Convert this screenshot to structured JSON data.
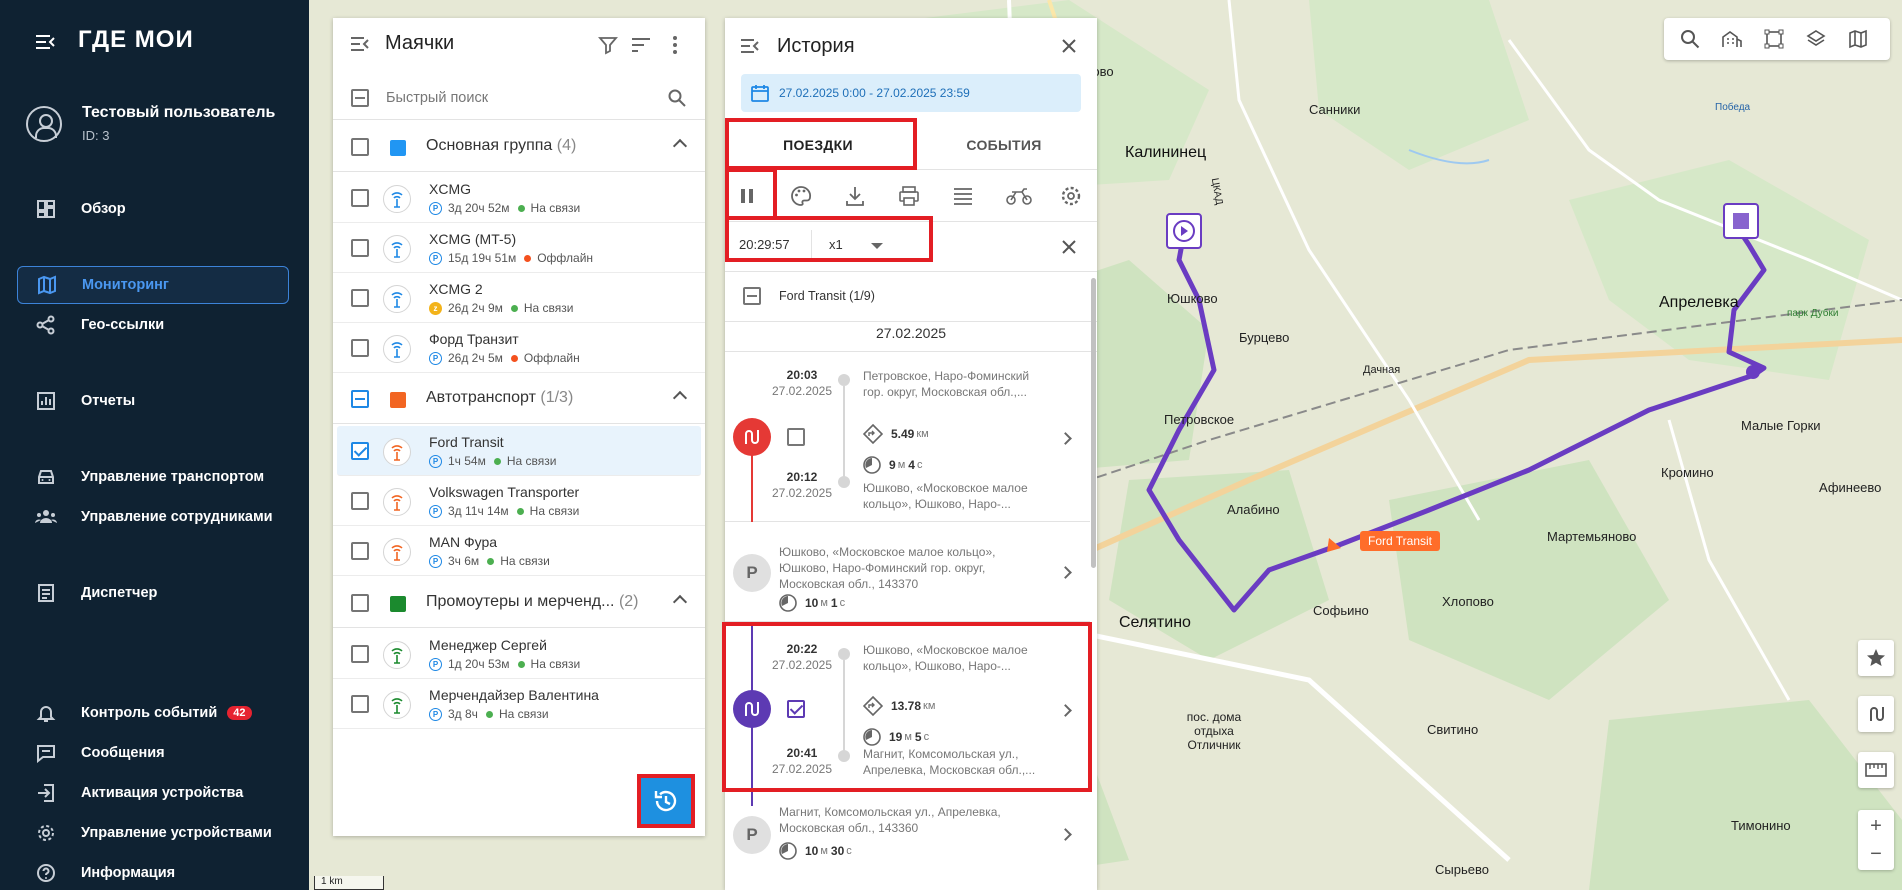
{
  "sidebar": {
    "logo": "ГДЕ МОИ",
    "user": {
      "name": "Тестовый пользователь",
      "id": "ID: 3"
    },
    "nav": [
      {
        "label": "Обзор",
        "icon": "dashboard-icon"
      },
      {
        "label": "Мониторинг",
        "icon": "map-icon",
        "active": true
      },
      {
        "label": "Гео-ссылки",
        "icon": "share-icon"
      },
      {
        "label": "Отчеты",
        "icon": "chart-icon"
      },
      {
        "label": "Управление транспортом",
        "icon": "car-icon"
      },
      {
        "label": "Управление сотрудниками",
        "icon": "people-icon"
      },
      {
        "label": "Диспетчер",
        "icon": "document-icon"
      },
      {
        "label": "Контроль событий",
        "icon": "bell-icon",
        "badge": "42"
      },
      {
        "label": "Сообщения",
        "icon": "message-icon"
      },
      {
        "label": "Активация устройства",
        "icon": "login-icon"
      },
      {
        "label": "Управление устройствами",
        "icon": "gear-icon"
      },
      {
        "label": "Информация",
        "icon": "help-icon"
      }
    ]
  },
  "beacons": {
    "title": "Маячки",
    "search_placeholder": "Быстрый поиск",
    "groups": [
      {
        "name": "Основная группа",
        "count": "(4)",
        "color": "#2196f3",
        "devices": [
          {
            "name": "XCMG",
            "duration": "3д 20ч 52м",
            "status": "На связи",
            "status_color": "#4caf50"
          },
          {
            "name": "XCMG (MT-5)",
            "duration": "15д 19ч 51м",
            "status": "Оффлайн",
            "status_color": "#f4511e"
          },
          {
            "name": "XCMG 2",
            "duration": "26д 2ч 9м",
            "status": "На связи",
            "status_color": "#4caf50"
          },
          {
            "name": "Форд Транзит",
            "duration": "26д 2ч 5м",
            "status": "Оффлайн",
            "status_color": "#f4511e"
          }
        ]
      },
      {
        "name": "Автотранспорт",
        "count": "(1/3)",
        "color": "#f26522",
        "devices": [
          {
            "name": "Ford Transit",
            "duration": "1ч 54м",
            "status": "На связи",
            "status_color": "#4caf50"
          },
          {
            "name": "Volkswagen Transporter",
            "duration": "3д 11ч 14м",
            "status": "На связи",
            "status_color": "#4caf50"
          },
          {
            "name": "MAN Фура",
            "duration": "3ч 6м",
            "status": "На связи",
            "status_color": "#4caf50"
          }
        ]
      },
      {
        "name": "Промоутеры и мерченд...",
        "count": "(2)",
        "color": "#1b8a2e",
        "devices": [
          {
            "name": "Менеджер Сергей",
            "duration": "1д 20ч 53м",
            "status": "На связи",
            "status_color": "#4caf50"
          },
          {
            "name": "Мерчендайзер Валентина",
            "duration": "3д 8ч",
            "status": "На связи",
            "status_color": "#4caf50"
          }
        ]
      }
    ]
  },
  "history": {
    "title": "История",
    "date_range": "27.02.2025 0:00 - 27.02.2025 23:59",
    "tabs": [
      "ПОЕЗДКИ",
      "СОБЫТИЯ"
    ],
    "player_time": "20:29:57",
    "speed": "x1",
    "trip_header": "Ford Transit",
    "trip_count": "(1/9)",
    "date": "27.02.2025",
    "entries": [
      {
        "type": "trip",
        "start_time": "20:03",
        "start_date": "27.02.2025",
        "start_addr": "Петровское, Наро-Фоминский гор. округ, Московская обл.,...",
        "end_time": "20:12",
        "end_date": "27.02.2025",
        "end_addr": "Юшково, «Московское малое кольцо», Юшково, Наро-...",
        "distance": "5.49",
        "distance_unit": "км",
        "min": "9",
        "sec": "4"
      },
      {
        "type": "parking",
        "addr": "Юшково, «Московское малое кольцо», Юшково, Наро-Фоминский гор. округ, Московская обл., 143370",
        "min": "10",
        "sec": "1"
      },
      {
        "type": "trip",
        "start_time": "20:22",
        "start_date": "27.02.2025",
        "start_addr": "Юшково, «Московское малое кольцо», Юшково, Наро-...",
        "end_time": "20:41",
        "end_date": "27.02.2025",
        "end_addr": "Магнит, Комсомольская ул., Апрелевка, Московская обл.,...",
        "distance": "13.78",
        "distance_unit": "км",
        "min": "19",
        "sec": "5"
      },
      {
        "type": "parking",
        "addr": "Магнит, Комсомольская ул., Апрелевка, Московская обл., 143360",
        "min": "10",
        "sec": "30"
      }
    ],
    "units": {
      "min": "м",
      "sec": "с"
    }
  },
  "map": {
    "labels": [
      "Тарасково",
      "Санники",
      "Калининец",
      "Победа",
      "Апрелевка",
      "парк Дубки",
      "Юшково",
      "Бурцево",
      "Дачная",
      "Петровское",
      "Малые Горки",
      "Алабино",
      "Кромино",
      "Афинеево",
      "Мартемьяново",
      "Селятино",
      "Софьино",
      "Хлопово",
      "пос. дома отдыха Отличник",
      "Свитино",
      "Тимонино",
      "Сырьево",
      "ЦКАД",
      "Ford Transit"
    ],
    "scale": "1 km",
    "route_color": "#6a3cc2"
  }
}
